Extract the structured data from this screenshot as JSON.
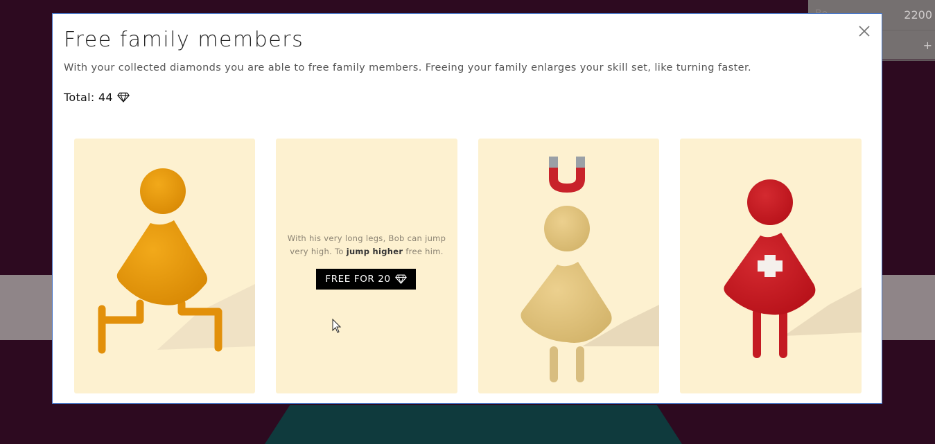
{
  "background": {
    "panel_rows": [
      {
        "label": "Bo",
        "value": "2200"
      },
      {
        "label": "",
        "value": "+"
      }
    ]
  },
  "modal": {
    "title": "Free family members",
    "description": "With your collected diamonds you are able to free family members. Freeing your family enlarges your skill set, like turning faster.",
    "total_label": "Total: 44",
    "close_icon": "close-icon",
    "diamond_icon": "diamond-icon"
  },
  "cards": [
    {
      "name": "orange-jumper",
      "color": "#e8960a",
      "locked": false
    },
    {
      "name": "bob",
      "locked": true,
      "text_before": "With his very long legs, Bob can jump very high. To ",
      "text_bold": "jump higher",
      "text_after": " free him.",
      "button_label": "FREE FOR 20"
    },
    {
      "name": "magnet-member",
      "color": "#e0c27e",
      "locked": false
    },
    {
      "name": "medic-member",
      "color": "#c8141c",
      "locked": false
    }
  ],
  "colors": {
    "card_bg": "#fdf1d0",
    "modal_border": "#4a78c8",
    "button_bg": "#000000"
  }
}
